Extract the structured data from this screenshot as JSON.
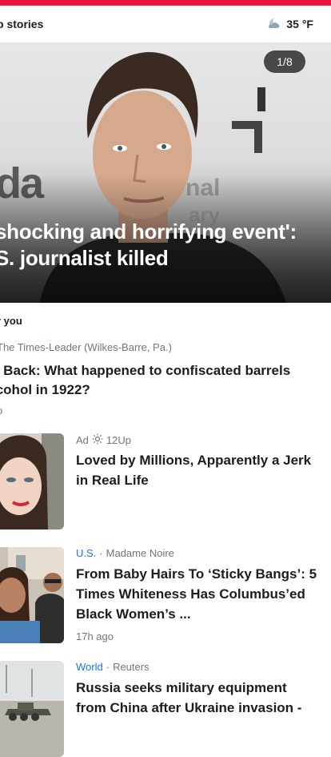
{
  "header": {
    "title": "p stories",
    "weather": {
      "icon": "moon-cloud-icon",
      "temp": "35 °F"
    }
  },
  "hero": {
    "counter": "1/8",
    "headline_line1": "shocking and horrifying event':",
    "headline_line2": "S. journalist killed",
    "wall_text_1": "da",
    "wall_text_2": "nal",
    "wall_text_3": "ary"
  },
  "feed": {
    "section_label": "r you",
    "story1": {
      "source": "The Times-Leader (Wilkes-Barre, Pa.)",
      "title": "k Back: What happened to confiscated barrels lcohol in 1922?",
      "time": "o"
    },
    "cards": [
      {
        "ad_label": "Ad",
        "source": "12Up",
        "title": "Loved by Millions, Apparently a Jerk in Real Life"
      },
      {
        "category": "U.S.",
        "source": "Madame Noire",
        "title": "From Baby Hairs To ‘Sticky Bangs’: 5 Times Whiteness Has Columbus’ed Black Women’s ...",
        "time": "17h ago"
      },
      {
        "category": "World",
        "source": "Reuters",
        "title": "Russia seeks military equipment from China after Ukraine invasion -"
      }
    ]
  },
  "colors": {
    "accent_red": "#e9183a",
    "link_blue": "#1a73e8",
    "meta_gray": "#6e7780"
  }
}
